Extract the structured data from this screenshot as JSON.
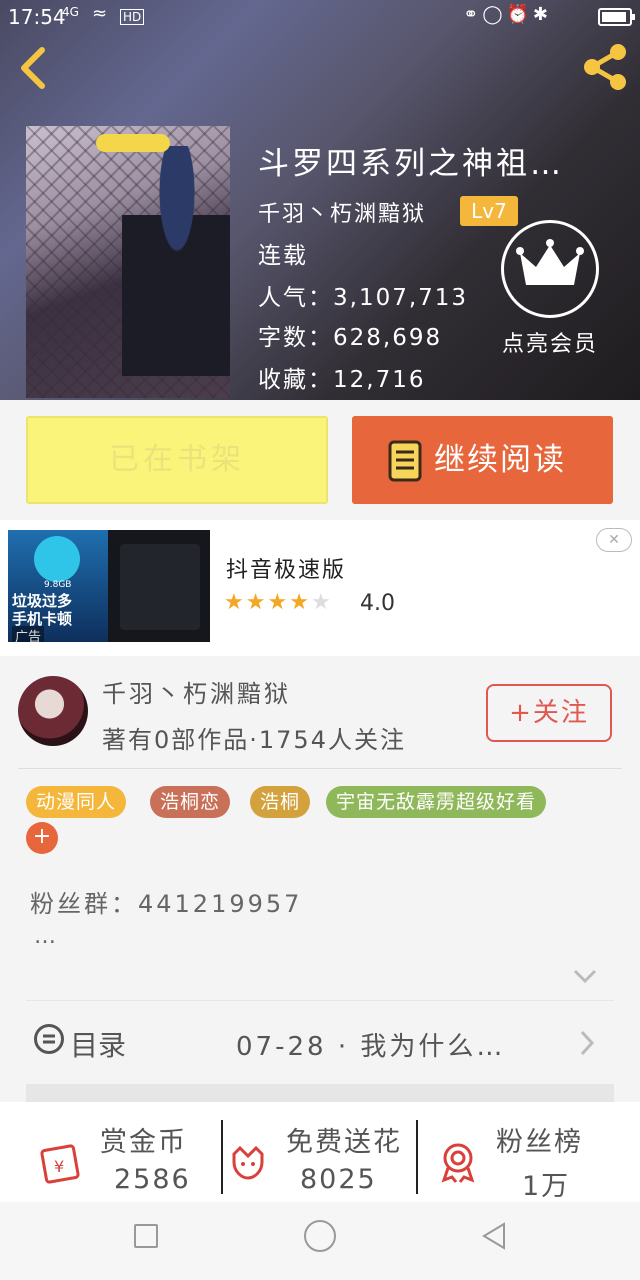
{
  "status_bar": {
    "time": "17:54",
    "network": "4G",
    "hd": "HD",
    "icons": [
      "mute-icon",
      "lock-rotation-icon",
      "alarm-icon",
      "bluetooth-icon",
      "battery-icon"
    ]
  },
  "header": {
    "back_icon": "chevron-left-icon",
    "share_icon": "share-icon"
  },
  "book": {
    "title": "斗罗四系列之神祖…",
    "author": "千羽丶朽渊黯狱",
    "author_level": "Lv7",
    "status": "连载",
    "popularity": "人气：3,107,713",
    "word_count": "字数：628,698",
    "favorites": "收藏：12,716",
    "vip_label": "点亮会员"
  },
  "actions": {
    "shelf_label": "已在书架",
    "read_label": "继续阅读"
  },
  "ad": {
    "title": "抖音极速版",
    "rating": "4.0",
    "stars_filled": 4,
    "stars_total": 5,
    "image_text": "垃圾过多\n手机卡顿",
    "image_size": "9.8GB",
    "image_tag": "广告",
    "close_icon": "close-icon"
  },
  "author_card": {
    "name": "千羽丶朽渊黯狱",
    "meta": "著有0部作品·1754人关注",
    "follow_label": "+关注"
  },
  "tags": [
    {
      "label": "动漫同人",
      "color": "#f5b73b"
    },
    {
      "label": "浩桐恋",
      "color": "#c97158"
    },
    {
      "label": "浩桐",
      "color": "#d4a23c"
    },
    {
      "label": "宇宙无敌霹雳超级好看",
      "color": "#8fb85b"
    }
  ],
  "tag_add_label": "+",
  "description": {
    "fan_group": "粉丝群：441219957",
    "more": "…"
  },
  "toc": {
    "label": "目录",
    "latest": "07-28 · 我为什么…"
  },
  "bottom": {
    "reward": {
      "title": "赏金币",
      "value": "2586"
    },
    "flower": {
      "title": "免费送花",
      "value": "8025"
    },
    "fans": {
      "title": "粉丝榜",
      "value": "1万"
    }
  },
  "colors": {
    "accent": "#e8663c",
    "shelf_button": "#fbf47a",
    "gold": "#f5b73b",
    "follow_red": "#e0584f",
    "icon_red": "#d9403a"
  }
}
